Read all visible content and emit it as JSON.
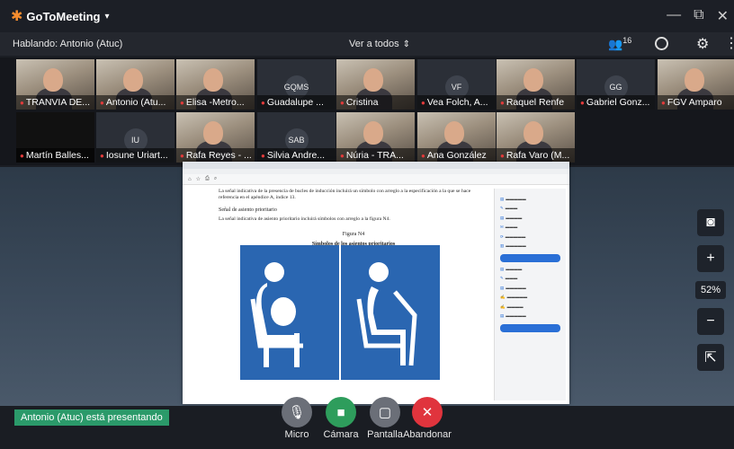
{
  "titlebar": {
    "logo_glyph": "✱",
    "title": "GoToMeeting",
    "caret": "▾",
    "controls": [
      "—",
      "⧉",
      "✕"
    ]
  },
  "infobar": {
    "speaking": "Hablando: Antonio (Atuc)",
    "view_all": "Ver a todos",
    "view_caret": "⇕",
    "participant_count": "16"
  },
  "participants": [
    {
      "name": "TRANVIA DE...",
      "type": "cam"
    },
    {
      "name": "Antonio (Atu...",
      "type": "cam"
    },
    {
      "name": "Elisa -Metro...",
      "type": "cam"
    },
    {
      "name": "Guadalupe ...",
      "type": "initials",
      "initials": "GQMS"
    },
    {
      "name": "Cristina",
      "type": "cam"
    },
    {
      "name": "Vea Folch, A...",
      "type": "initials",
      "initials": "VF"
    },
    {
      "name": "Raquel Renfe",
      "type": "cam"
    },
    {
      "name": "Gabriel Gonz...",
      "type": "initials",
      "initials": "GG"
    },
    {
      "name": "FGV Amparo",
      "type": "cam"
    },
    {
      "name": "Martín Balles...",
      "type": "dark"
    },
    {
      "name": "Iosune Uriart...",
      "type": "initials",
      "initials": "IU"
    },
    {
      "name": "Rafa Reyes - ...",
      "type": "cam"
    },
    {
      "name": "Silvia Andre...",
      "type": "initials",
      "initials": "SAB"
    },
    {
      "name": "Núria - TRA...",
      "type": "cam"
    },
    {
      "name": "Ana González",
      "type": "cam"
    },
    {
      "name": "Rafa Varo (M...",
      "type": "cam"
    }
  ],
  "document": {
    "para1": "La señal indicativa de la presencia de bucles de inducción incluirá un símbolo con arreglo a la especificación a la que se hace referencia en el apéndice A, índice 13.",
    "heading": "Señal de asiento prioritario",
    "para2": "La señal indicativa de asiento prioritario incluirá símbolos con arreglo a la figura N4.",
    "figure_label": "Figura N4",
    "figure_title": "Símbolos de los asientos prioritarios",
    "symbol_color": "#2a66b1"
  },
  "tools": {
    "camera_glyph": "◙",
    "zoom_in_glyph": "+",
    "zoom_level": "52%",
    "zoom_out_glyph": "−",
    "popout_glyph": "⇱"
  },
  "bottom": {
    "presenting_text": "Antonio (Atuc) está presentando",
    "controls": [
      {
        "label": "Micro",
        "glyph": "🎙",
        "color": "#6b6f78"
      },
      {
        "label": "Cámara",
        "glyph": "■",
        "color": "#2e9d5c"
      },
      {
        "label": "Pantalla",
        "glyph": "▢",
        "color": "#6b6f78"
      },
      {
        "label": "Abandonar",
        "glyph": "✕",
        "color": "#e0343d"
      }
    ]
  }
}
